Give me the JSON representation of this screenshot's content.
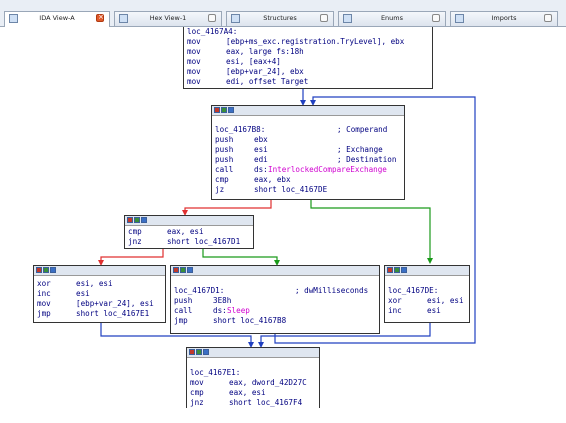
{
  "tabs": [
    {
      "label": "IDA View-A",
      "active": true
    },
    {
      "label": "Hex View-1"
    },
    {
      "label": "Structures"
    },
    {
      "label": "Enums"
    },
    {
      "label": "Imports"
    }
  ],
  "colors": {
    "edge_true": "#1a9a1a",
    "edge_false": "#e03030",
    "edge_jump": "#2040c0",
    "header": "#dfe6f0"
  },
  "nodes": {
    "top": {
      "lines": [
        {
          "mnem": "loc_4167A4:",
          "ops": ""
        },
        {
          "mnem": "mov",
          "ops": "[ebp+ms_exc.registration.TryLevel], ebx"
        },
        {
          "mnem": "mov",
          "ops": "eax, large fs:18h"
        },
        {
          "mnem": "mov",
          "ops": "esi, [eax+4]"
        },
        {
          "mnem": "mov",
          "ops": "[ebp+var_24], ebx"
        },
        {
          "mnem": "mov",
          "ops": "edi, offset Target"
        }
      ]
    },
    "cmpx": {
      "label": "loc_4167B8:",
      "label_comment": "; Comperand",
      "lines": [
        {
          "mnem": "push",
          "ops": "ebx",
          "comment": ""
        },
        {
          "mnem": "push",
          "ops": "esi",
          "comment": "; Exchange"
        },
        {
          "mnem": "push",
          "ops": "edi",
          "comment": "; Destination"
        },
        {
          "mnem": "call",
          "ops_prefix": "ds:",
          "ops_func": "InterlockedCompareExchange",
          "comment": ""
        },
        {
          "mnem": "cmp",
          "ops": "eax, ebx",
          "comment": ""
        },
        {
          "mnem": "jz",
          "ops": "short loc_4167DE",
          "comment": ""
        }
      ]
    },
    "cmpesi": {
      "lines": [
        {
          "mnem": "cmp",
          "ops": "eax, esi"
        },
        {
          "mnem": "jnz",
          "ops": "short loc_4167D1"
        }
      ]
    },
    "xor": {
      "lines": [
        {
          "mnem": "xor",
          "ops": "esi, esi"
        },
        {
          "mnem": "inc",
          "ops": "esi"
        },
        {
          "mnem": "mov",
          "ops": "[ebp+var_24], esi"
        },
        {
          "mnem": "jmp",
          "ops": "short loc_4167E1"
        }
      ]
    },
    "sleep": {
      "label": "loc_4167D1:",
      "label_comment": "; dwMilliseconds",
      "lines": [
        {
          "mnem": "push",
          "ops": "3E8h"
        },
        {
          "mnem": "call",
          "ops_prefix": "ds:",
          "ops_func": "Sleep"
        },
        {
          "mnem": "jmp",
          "ops": "short loc_4167B8"
        }
      ]
    },
    "de": {
      "label": "loc_4167DE:",
      "lines": [
        {
          "mnem": "xor",
          "ops": "esi, esi"
        },
        {
          "mnem": "inc",
          "ops": "esi"
        }
      ]
    },
    "e1": {
      "label": "loc_4167E1:",
      "lines": [
        {
          "mnem": "mov",
          "ops": "eax, dword_42D27C"
        },
        {
          "mnem": "cmp",
          "ops": "eax, esi"
        },
        {
          "mnem": "jnz",
          "ops": "short loc_4167F4"
        }
      ]
    }
  }
}
